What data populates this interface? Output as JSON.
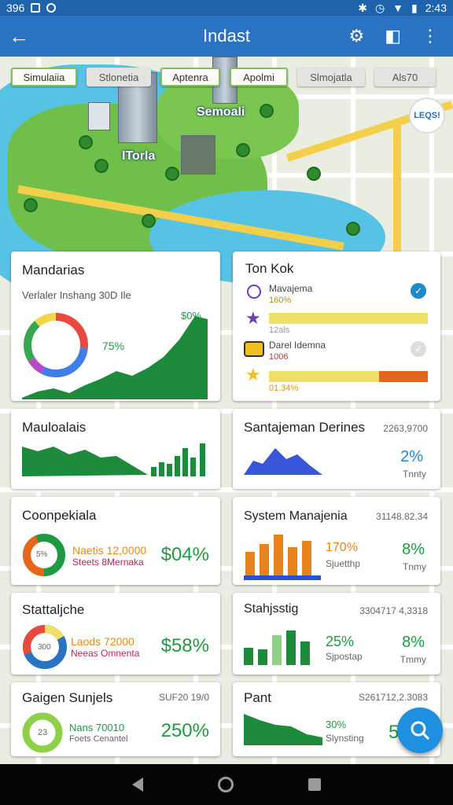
{
  "status_bar": {
    "left_text": "396",
    "time": "2:43"
  },
  "app_bar": {
    "title": "Indast"
  },
  "chips": [
    "Simulaiia",
    "Stlonetia",
    "Aptenra",
    "Apolmi",
    "Slmojatla",
    "Als70"
  ],
  "map": {
    "label_main": "Semoali",
    "label_left": "ITorla",
    "badge": "LEQS!"
  },
  "cards": {
    "mandarias": {
      "title": "Mandarias",
      "subtitle": "Verlaler Inshang 30D Ile",
      "donut_pct": "75%",
      "peak": "$0%"
    },
    "tonkok": {
      "title": "Ton Kok",
      "row1_name": "Mavajema",
      "row1_value": "160%",
      "row1_meta": "12als",
      "row2_name": "Darel Idemna",
      "row2_value": "1006",
      "row2_meta": "01.34%"
    },
    "mauloalais": {
      "title": "Mauloalais"
    },
    "santajeman": {
      "title": "Santajeman Derines",
      "value": "2263,9700",
      "pct": "2%",
      "label": "Tnnty"
    },
    "coonpekiala": {
      "title": "Coonpekiala",
      "donut": "5%",
      "line1": "Naetis 12,0000",
      "line2": "Steets 8Mernaka",
      "pct": "$04%"
    },
    "system": {
      "title": "System Manajenia",
      "value": "31148.82,34",
      "pct1": "170%",
      "label1": "Sjuetthp",
      "pct2": "8%",
      "label2": "Tnmy"
    },
    "stattaljche": {
      "title": "Stattaljche",
      "donut": "300",
      "line1": "Laods 72000",
      "line2": "Neeas Omnenta",
      "pct": "$58%"
    },
    "stahjsstig": {
      "title": "Stahjsstig",
      "value": "3304717 4,3318",
      "pct1": "25%",
      "label1": "Sjpostap",
      "pct2": "8%",
      "label2": "Tmmy"
    },
    "gaigen": {
      "title": "Gaigen Sunjels",
      "value": "SUF20 19/0",
      "donut": "23",
      "line1": "Nans 70010",
      "line2": "Foets Cenantel",
      "pct": "250%"
    },
    "pant": {
      "title": "Pant",
      "value": "S261712,2.3083",
      "pct1": "30%",
      "label1": "Slynsting",
      "pct2": "5"
    }
  },
  "colors": {
    "appbar": "#2a73c2",
    "green": "#1e9a42",
    "blue": "#1d89c9",
    "orange": "#e88a12",
    "yellow": "#efe06a"
  }
}
